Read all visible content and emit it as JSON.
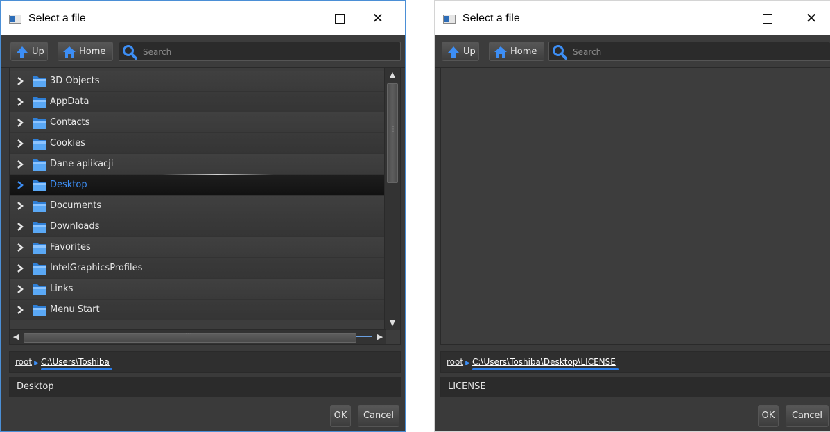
{
  "dialogs": [
    {
      "title": "Select a file",
      "toolbar": {
        "up_label": "Up",
        "home_label": "Home",
        "search_placeholder": "Search"
      },
      "tree_items": [
        {
          "label": "3D Objects"
        },
        {
          "label": "AppData"
        },
        {
          "label": "Contacts"
        },
        {
          "label": "Cookies"
        },
        {
          "label": "Dane aplikacji"
        },
        {
          "label": "Desktop",
          "selected": true
        },
        {
          "label": "Documents"
        },
        {
          "label": "Downloads"
        },
        {
          "label": "Favorites"
        },
        {
          "label": "IntelGraphicsProfiles"
        },
        {
          "label": "Links"
        },
        {
          "label": "Menu Start"
        }
      ],
      "breadcrumb": {
        "root": "root",
        "path": "C:\\Users\\Toshiba"
      },
      "filename": "Desktop",
      "buttons": {
        "ok": "OK",
        "cancel": "Cancel"
      }
    },
    {
      "title": "Select a file",
      "toolbar": {
        "up_label": "Up",
        "home_label": "Home",
        "search_placeholder": "Search"
      },
      "tree_items": [],
      "breadcrumb": {
        "root": "root",
        "path": "C:\\Users\\Toshiba\\Desktop\\LICENSE"
      },
      "filename": "LICENSE",
      "buttons": {
        "ok": "OK",
        "cancel": "Cancel"
      }
    }
  ],
  "colors": {
    "accent": "#3d8ef5",
    "folder": "#4a9bf0",
    "background": "#3a3a3a"
  },
  "icons": {
    "window": "app-window-icon",
    "minimize": "minimize-icon",
    "maximize": "maximize-icon",
    "close": "close-icon",
    "up": "arrow-up-icon",
    "home": "home-icon",
    "search": "search-icon",
    "folder": "folder-icon",
    "expand": "chevron-right-icon"
  }
}
